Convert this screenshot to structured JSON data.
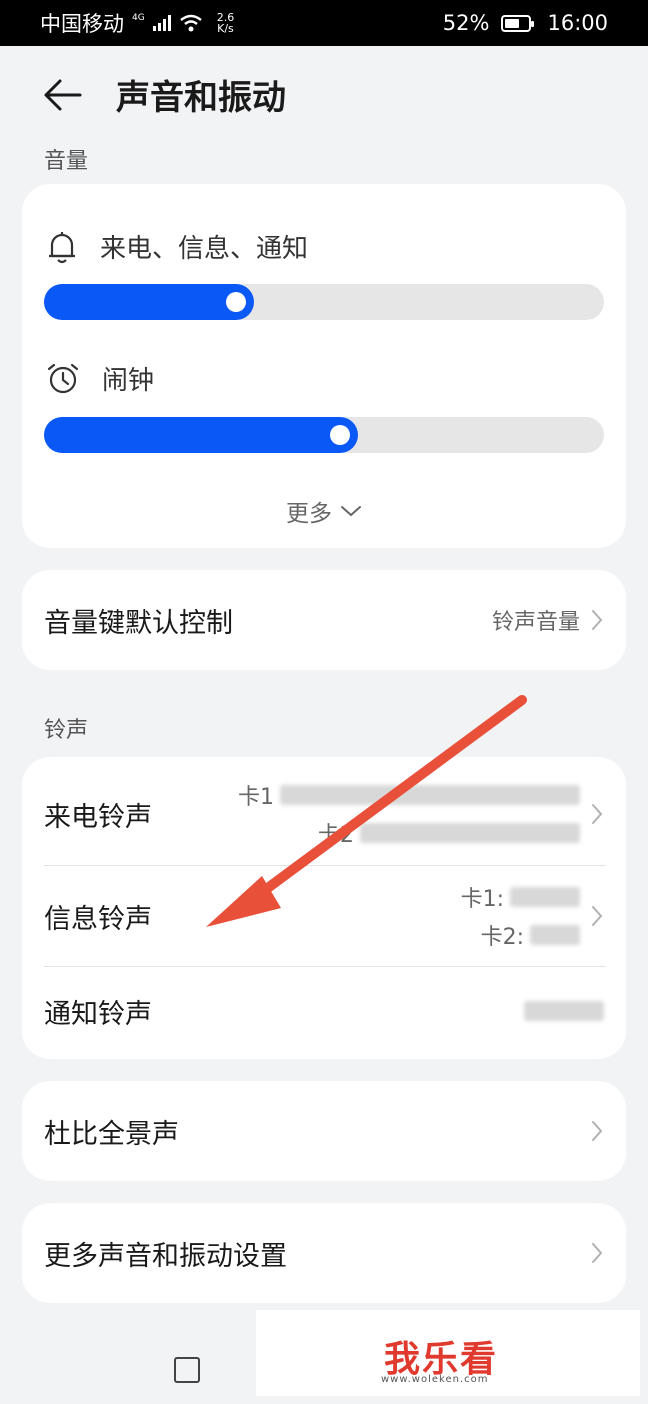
{
  "status_bar": {
    "carrier": "中国移动",
    "net_type": "4G",
    "speed_value": "2.6",
    "speed_unit": "K/s",
    "battery": "52%",
    "time": "16:00"
  },
  "header": {
    "title": "声音和振动"
  },
  "volume": {
    "section_label": "音量",
    "ringer": {
      "label": "来电、信息、通知",
      "level": 0.375
    },
    "alarm": {
      "label": "闹钟",
      "level": 0.56
    },
    "more_label": "更多"
  },
  "volume_key": {
    "title": "音量键默认控制",
    "value": "铃声音量"
  },
  "ringtones": {
    "section_label": "铃声",
    "items": [
      {
        "title": "来电铃声",
        "sim1": "卡1",
        "sim2": "卡2"
      },
      {
        "title": "信息铃声",
        "sim1": "卡1:",
        "sim2": "卡2:"
      },
      {
        "title": "通知铃声"
      }
    ]
  },
  "dolby": {
    "title": "杜比全景声"
  },
  "more_settings": {
    "title": "更多声音和振动设置"
  },
  "watermark": {
    "text": "我乐看",
    "url": "www.woleken.com"
  },
  "colors": {
    "accent": "#0a59f7",
    "arrow": "#e8503a"
  }
}
